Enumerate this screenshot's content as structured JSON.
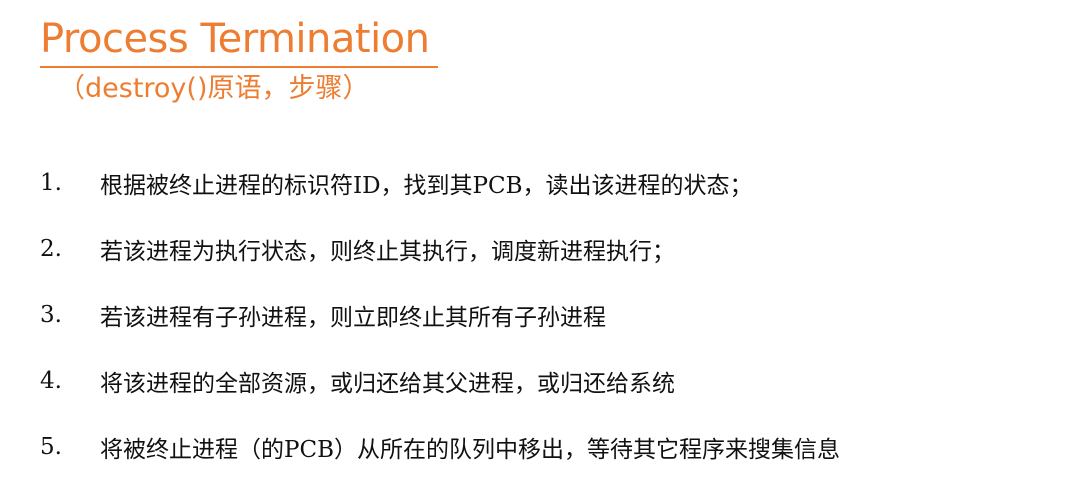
{
  "title": "Process Termination",
  "subtitle": "（destroy()原语，步骤）",
  "steps": [
    {
      "num": "1.",
      "text": "根据被终止进程的标识符ID，找到其PCB，读出该进程的状态；"
    },
    {
      "num": "2.",
      "text": "若该进程为执行状态，则终止其执行，调度新进程执行；"
    },
    {
      "num": "3.",
      "text": "若该进程有子孙进程，则立即终止其所有子孙进程"
    },
    {
      "num": "4.",
      "text": "将该进程的全部资源，或归还给其父进程，或归还给系统"
    },
    {
      "num": "5.",
      "text": "将被终止进程（的PCB）从所在的队列中移出，等待其它程序来搜集信息"
    }
  ],
  "colors": {
    "accent": "#ed7d31",
    "text": "#111111"
  }
}
